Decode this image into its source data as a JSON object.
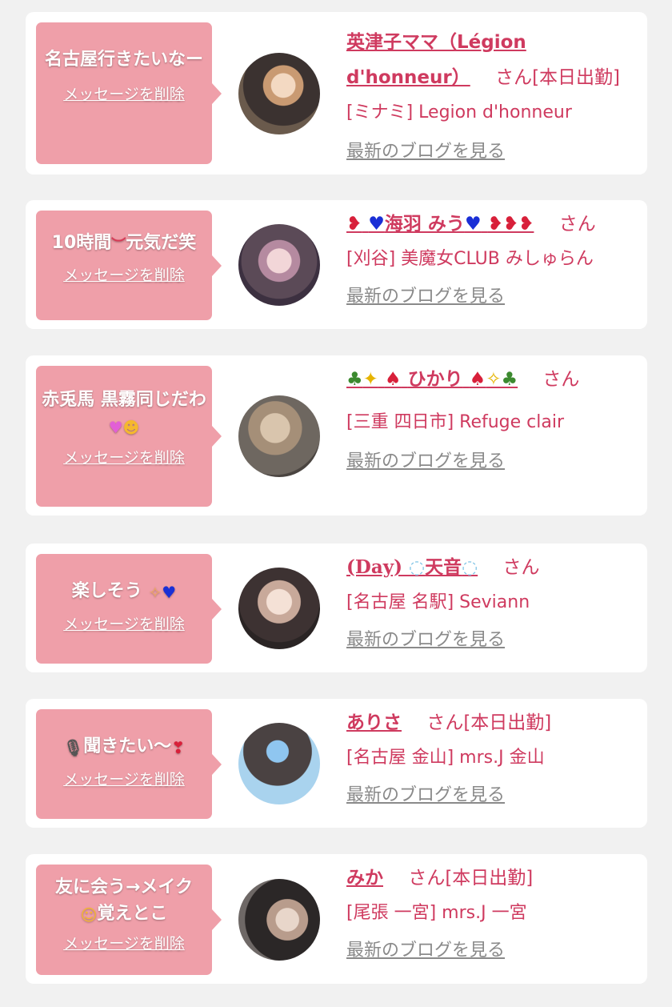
{
  "cards": [
    {
      "message_parts": [
        "名古屋行きたいなー"
      ],
      "delete_label": "メッセージを削除",
      "name": "英津子ママ（Légion d'honneur）",
      "san": "さん",
      "status": "[本日出勤]",
      "shop": "[ミナミ] Legion d'honneur",
      "blog_label": "最新のブログを見る",
      "avatar_colors": [
        "#5a4a3a",
        "#e7c9a8",
        "#2b2b2b"
      ]
    },
    {
      "message_parts": [
        "10時間",
        "元気だ笑"
      ],
      "message_emoji": "sad-face-emoji",
      "delete_label": "メッセージを削除",
      "name_core": "海羽 みう",
      "san": "さん",
      "status": "",
      "shop": "[刈谷] 美魔女CLUB みしゅらん",
      "blog_label": "最新のブログを見る",
      "avatar_colors": [
        "#6b5b73",
        "#e8b7c9",
        "#d986e6"
      ]
    },
    {
      "message_parts": [
        "赤兎馬 黒霧同じだわ"
      ],
      "message_emoji": [
        "pink-heart-emoji",
        "laughing-face-emoji"
      ],
      "delete_label": "メッセージを削除",
      "name_core": "ひかり",
      "san": "さん",
      "status": "",
      "shop": "[三重 四日市] Refuge clair",
      "blog_label": "最新のブログを見る",
      "avatar_colors": [
        "#8f8b85",
        "#d8c7b2",
        "#4b4440"
      ]
    },
    {
      "message_parts": [
        "楽しそう"
      ],
      "message_emoji": [
        "sparkle-emoji",
        "blue-heart-emoji"
      ],
      "delete_label": "メッセージを削除",
      "name_prefix": "(Day)",
      "name_core": "天音",
      "san": "さん",
      "status": "",
      "shop": "[名古屋 名駅] Seviann",
      "blog_label": "最新のブログを見る",
      "avatar_colors": [
        "#3a3030",
        "#f0d9cc",
        "#7a6a60"
      ]
    },
    {
      "message_parts": [
        "聞きたい〜"
      ],
      "message_emoji": [
        "microphone-emoji",
        "hearts-emoji"
      ],
      "delete_label": "メッセージを削除",
      "name": "ありさ",
      "san": "さん",
      "status": "[本日出勤]",
      "shop": "[名古屋 金山] mrs.J 金山",
      "blog_label": "最新のブログを見る",
      "avatar_colors": [
        "#a9d3ee",
        "#3a3a3a",
        "#5ba0e0"
      ]
    },
    {
      "message_parts": [
        "友に会う→メイク",
        "覚えとこ"
      ],
      "message_emoji": "hand-over-mouth-emoji",
      "delete_label": "メッセージを削除",
      "name": "みか",
      "san": "さん",
      "status": "[本日出勤]",
      "shop": "[尾張 一宮] mrs.J 一宮",
      "blog_label": "最新のブログを見る",
      "avatar_colors": [
        "#2d2a2a",
        "#e3d1c4",
        "#8a7f7a"
      ]
    }
  ],
  "colors": {
    "accent": "#cf3a5f",
    "bubble": "#ef9fa9",
    "link_gray": "#8a8a8a",
    "background": "#f1f1f1"
  }
}
